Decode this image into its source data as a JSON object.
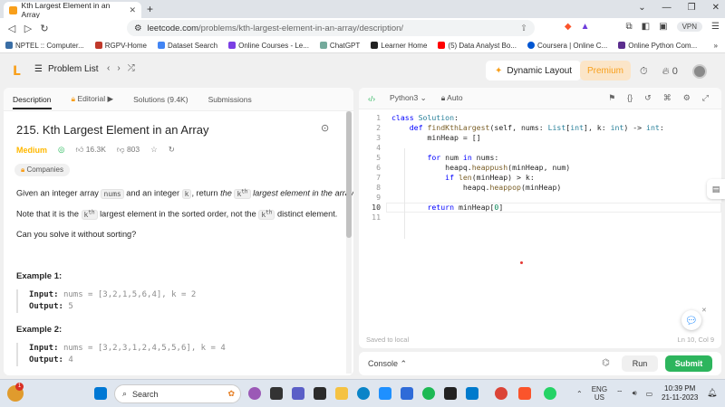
{
  "browser": {
    "tab_title": "Kth Largest Element in an Array",
    "url_host": "leetcode.com",
    "url_path": "/problems/kth-largest-element-in-an-array/description/",
    "vpn_label": "VPN",
    "bookmarks": [
      "NPTEL :: Computer...",
      "RGPV-Home",
      "Dataset Search",
      "Online Courses - Le...",
      "ChatGPT",
      "Learner Home",
      "(5) Data Analyst Bo...",
      "Coursera | Online C...",
      "Online Python Com..."
    ]
  },
  "lc_nav": {
    "problem_list": "Problem List",
    "dynamic_layout": "Dynamic Layout",
    "premium": "Premium",
    "streak": "0"
  },
  "left": {
    "tabs": [
      "Description",
      "Editorial",
      "Solutions (9.4K)",
      "Submissions"
    ],
    "title": "215. Kth Largest Element in an Array",
    "difficulty": "Medium",
    "likes": "16.3K",
    "dislikes": "803",
    "companies": "Companies",
    "desc1_a": "Given an integer array",
    "desc1_code1": "nums",
    "desc1_b": "and an integer",
    "desc1_code2": "k",
    "desc1_c": ", return",
    "desc1_em": "the",
    "desc1_code3": "k",
    "desc1_sup": "th",
    "desc1_d": "largest element in the array.",
    "desc2_a": "Note that it is the",
    "desc2_code1": "k",
    "desc2_sup1": "th",
    "desc2_b": "largest element in the sorted order, not the",
    "desc2_code2": "k",
    "desc2_sup2": "th",
    "desc2_c": "distinct element.",
    "desc3": "Can you solve it without sorting?",
    "example1_title": "Example 1:",
    "example1_input_label": "Input:",
    "example1_input": "nums = [3,2,1,5,6,4], k = 2",
    "example1_output_label": "Output:",
    "example1_output": "5",
    "example2_title": "Example 2:",
    "example2_input_label": "Input:",
    "example2_input": "nums = [3,2,3,1,2,4,5,5,6], k = 4",
    "example2_output_label": "Output:",
    "example2_output": "4"
  },
  "editor": {
    "language": "Python3",
    "mode": "Auto",
    "line_numbers": [
      "1",
      "2",
      "3",
      "4",
      "5",
      "6",
      "7",
      "8",
      "9",
      "10",
      "11"
    ],
    "saved_status": "Saved to local",
    "cursor_pos": "Ln 10, Col 9",
    "console": "Console",
    "run": "Run",
    "submit": "Submit"
  },
  "taskbar": {
    "search_placeholder": "Search",
    "lang": "ENG",
    "region": "US",
    "time": "10:39 PM",
    "date": "21-11-2023",
    "notification_count": "1"
  }
}
